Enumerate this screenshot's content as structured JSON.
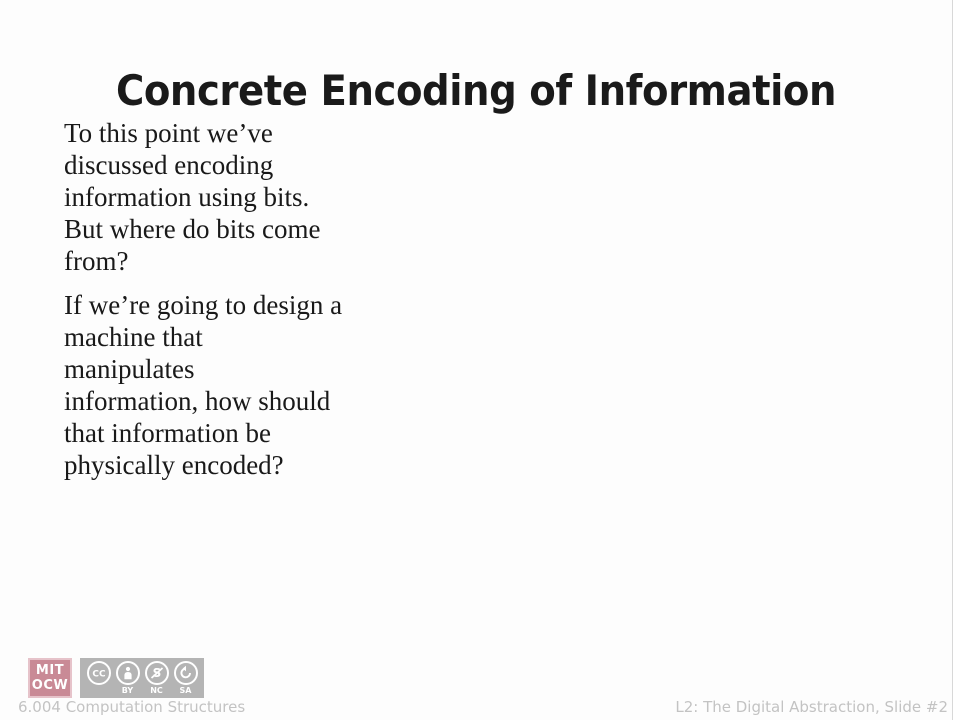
{
  "slide": {
    "title": "Concrete Encoding of Information",
    "paragraphs": [
      {
        "lines": [
          "To this point we’ve",
          "discussed encoding",
          "information using bits.",
          "But where do bits come",
          "from?"
        ]
      },
      {
        "lines": [
          "If we’re going to design a",
          "machine that",
          "manipulates",
          "information, how should",
          "that information be",
          "physically encoded?"
        ]
      }
    ]
  },
  "footer": {
    "course": "6.004 Computation Structures",
    "lecture_info": "L2: The Digital Abstraction, Slide #2"
  },
  "logos": {
    "mit_ocw": {
      "line1": "MIT",
      "line2": "OCW",
      "color": "#c98a96"
    },
    "creative_commons": {
      "background": "#b4b4b4",
      "items": [
        {
          "icon": "cc-icon",
          "glyph": "CC",
          "label": ""
        },
        {
          "icon": "attribution-person-icon",
          "glyph": "",
          "label": "BY"
        },
        {
          "icon": "noncommercial-dollar-slash-icon",
          "glyph": "",
          "label": "NC"
        },
        {
          "icon": "sharealike-arrow-icon",
          "glyph": "",
          "label": "SA"
        }
      ]
    }
  },
  "colors": {
    "title": "#1a1a1a",
    "body": "#191919",
    "footer": "#c3c3c3",
    "background": "#fdfdfd"
  }
}
